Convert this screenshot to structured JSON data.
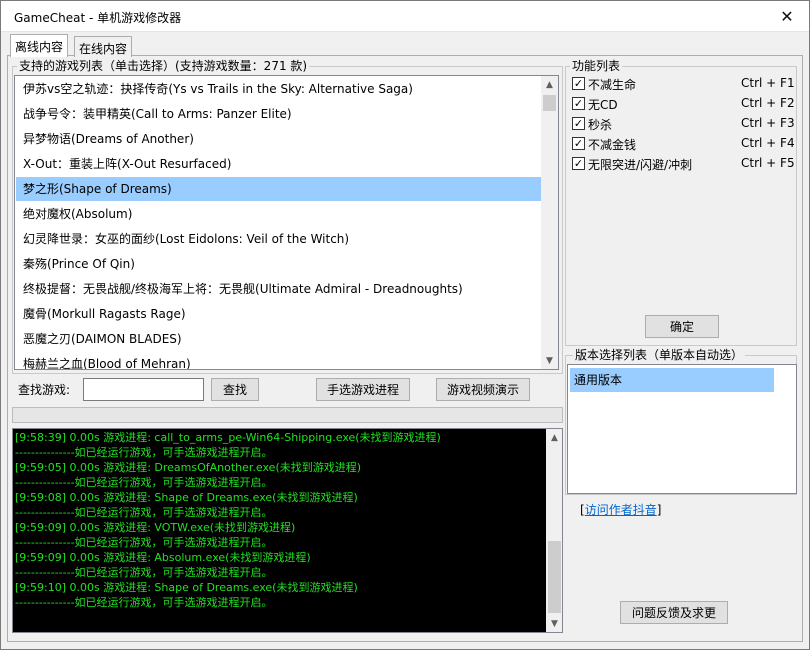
{
  "window": {
    "title": "GameCheat - 单机游戏修改器",
    "close_glyph": "✕"
  },
  "tabs": [
    {
      "label": "离线内容",
      "active": true
    },
    {
      "label": "在线内容",
      "active": false
    }
  ],
  "game_list": {
    "label": "支持的游戏列表（单击选择）(支持游戏数量：271 款)",
    "items": [
      "伊苏vs空之轨迹：抉择传奇(Ys vs Trails in the Sky: Alternative Saga)",
      "战争号令：装甲精英(Call to Arms: Panzer Elite)",
      "异梦物语(Dreams of Another)",
      "X-Out：重装上阵(X-Out Resurfaced)",
      "梦之形(Shape of Dreams)",
      "绝对魔权(Absolum)",
      "幻灵降世录：女巫的面纱(Lost Eidolons: Veil of the Witch)",
      "秦殇(Prince Of Qin)",
      "终极提督：无畏战舰/终极海军上将：无畏舰(Ultimate Admiral - Dreadnoughts)",
      "魔骨(Morkull Ragasts Rage)",
      "恶魔之刃(DAIMON BLADES)",
      "梅赫兰之血(Blood of Mehran)"
    ],
    "selected_index": 4
  },
  "search": {
    "label": "查找游戏:",
    "value": "",
    "find_button": "查找",
    "manual_select_button": "手选游戏进程",
    "video_demo_button": "游戏视频演示"
  },
  "log": {
    "lines": [
      "[9:58:39] 0.00s 游戏进程: call_to_arms_pe-Win64-Shipping.exe(未找到游戏进程)",
      "---------------如已经运行游戏，可手选游戏进程开启。",
      "[9:59:05] 0.00s 游戏进程: DreamsOfAnother.exe(未找到游戏进程)",
      "---------------如已经运行游戏，可手选游戏进程开启。",
      "[9:59:08] 0.00s 游戏进程: Shape of Dreams.exe(未找到游戏进程)",
      "---------------如已经运行游戏，可手选游戏进程开启。",
      "[9:59:09] 0.00s 游戏进程: VOTW.exe(未找到游戏进程)",
      "---------------如已经运行游戏，可手选游戏进程开启。",
      "[9:59:09] 0.00s 游戏进程: Absolum.exe(未找到游戏进程)",
      "---------------如已经运行游戏，可手选游戏进程开启。",
      "[9:59:10] 0.00s 游戏进程: Shape of Dreams.exe(未找到游戏进程)",
      "---------------如已经运行游戏，可手选游戏进程开启。"
    ],
    "text_color": "#22e022"
  },
  "features": {
    "label": "功能列表",
    "items": [
      {
        "label": "不减生命",
        "hotkey": "Ctrl + F1",
        "checked": true
      },
      {
        "label": "无CD",
        "hotkey": "Ctrl + F2",
        "checked": true
      },
      {
        "label": "秒杀",
        "hotkey": "Ctrl + F3",
        "checked": true
      },
      {
        "label": "不减金钱",
        "hotkey": "Ctrl + F4",
        "checked": true
      },
      {
        "label": "无限突进/闪避/冲刺",
        "hotkey": "Ctrl + F5",
        "checked": true
      }
    ],
    "check_glyph": "✓",
    "confirm_button": "确定"
  },
  "versions": {
    "label": "版本选择列表（单版本自动选）",
    "items": [
      "通用版本"
    ],
    "selected_index": 0
  },
  "links": {
    "author_bracket_open": "[",
    "author": "访问作者抖音",
    "author_bracket_close": "]"
  },
  "feedback_button": "问题反馈及求更",
  "colors": {
    "selection": "#99ccff",
    "log_background": "#000000",
    "link": "#0066cc"
  }
}
